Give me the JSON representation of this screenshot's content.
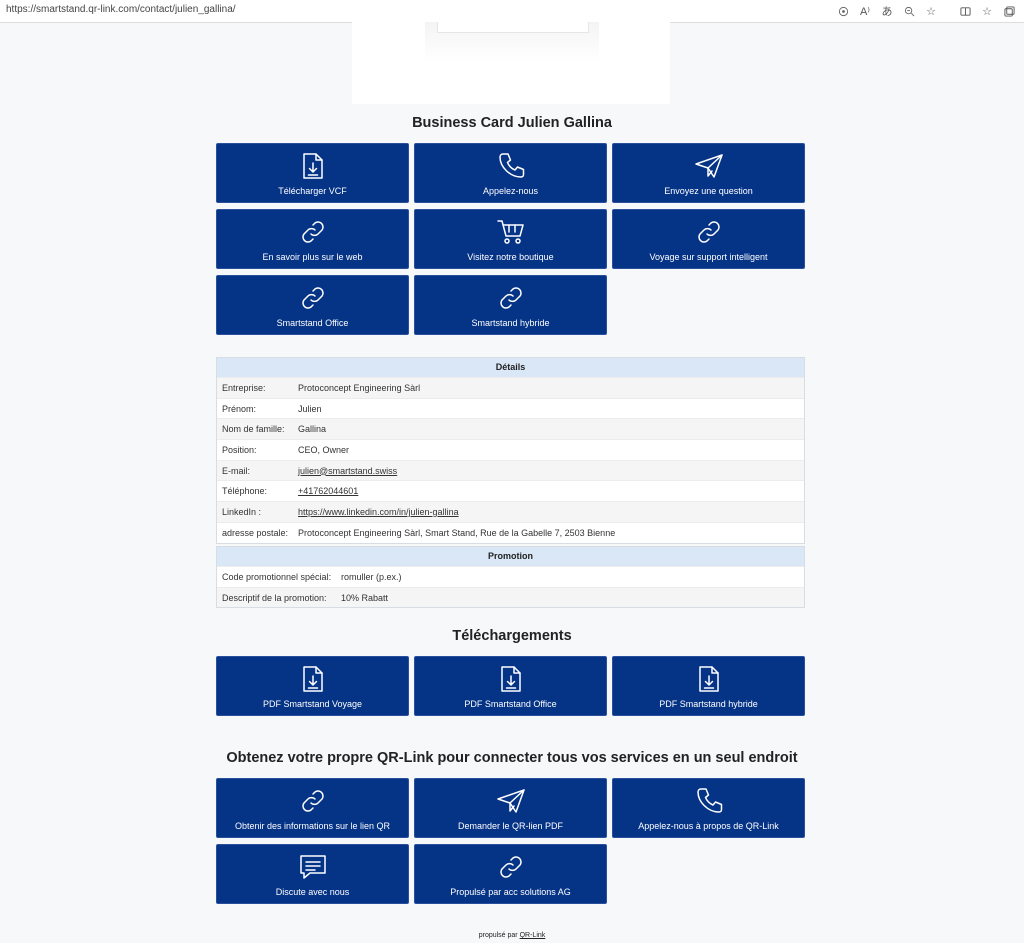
{
  "browser": {
    "url": "https://smartstand.qr-link.com/contact/julien_gallina/",
    "icons": [
      "location-icon",
      "read-aloud-icon",
      "translate-icon",
      "zoom-icon",
      "favorite-icon",
      "split-screen-icon",
      "favorites-icon",
      "collections-icon"
    ]
  },
  "title": "Business Card Julien Gallina",
  "actions": [
    {
      "label": "Télécharger VCF",
      "icon": "file-download-icon"
    },
    {
      "label": "Appelez-nous",
      "icon": "phone-icon"
    },
    {
      "label": "Envoyez une question",
      "icon": "send-icon"
    },
    {
      "label": "En savoir plus sur le web",
      "icon": "link-icon"
    },
    {
      "label": "Visitez notre boutique",
      "icon": "cart-icon"
    },
    {
      "label": "Voyage sur support intelligent",
      "icon": "link-icon"
    },
    {
      "label": "Smartstand Office",
      "icon": "link-icon"
    },
    {
      "label": "Smartstand hybride",
      "icon": "link-icon"
    }
  ],
  "details": {
    "heading": "Détails",
    "rows": [
      {
        "key": "Entreprise:",
        "value": "Protoconcept Engineering Sàrl"
      },
      {
        "key": "Prénom:",
        "value": "Julien"
      },
      {
        "key": "Nom de famille:",
        "value": "Gallina"
      },
      {
        "key": "Position:",
        "value": "CEO, Owner"
      },
      {
        "key": "E-mail:",
        "value": "julien@smartstand.swiss"
      },
      {
        "key": "Téléphone:",
        "value": "+41762044601"
      },
      {
        "key": "LinkedIn :",
        "value": "https://www.linkedin.com/in/julien-gallina"
      },
      {
        "key": "adresse postale:",
        "value": "Protoconcept Engineering Sàrl, Smart Stand, Rue de la Gabelle 7, 2503 Bienne"
      }
    ]
  },
  "promotion": {
    "heading": "Promotion",
    "rows": [
      {
        "key": "Code promotionnel spécial:",
        "value": "romuller (p.ex.)"
      },
      {
        "key": "Descriptif de la promotion:",
        "value": "10% Rabatt"
      }
    ]
  },
  "downloads_title": "Téléchargements",
  "downloads": [
    {
      "label": "PDF Smartstand Voyage",
      "icon": "file-download-icon"
    },
    {
      "label": "PDF Smartstand Office",
      "icon": "file-download-icon"
    },
    {
      "label": "PDF Smartstand hybride",
      "icon": "file-download-icon"
    }
  ],
  "qr_title": "Obtenez votre propre QR-Link pour connecter tous vos services en un seul endroit",
  "qr_actions": [
    {
      "label": "Obtenir des informations sur le lien QR",
      "icon": "link-icon"
    },
    {
      "label": "Demander le QR-lien PDF",
      "icon": "send-icon"
    },
    {
      "label": "Appelez-nous à propos de QR-Link",
      "icon": "phone-icon"
    },
    {
      "label": "Discute avec nous",
      "icon": "chat-icon"
    },
    {
      "label": "Propulsé par acc solutions AG",
      "icon": "link-icon"
    }
  ],
  "footer": {
    "text": "propulsé par",
    "link": "QR-Link"
  }
}
